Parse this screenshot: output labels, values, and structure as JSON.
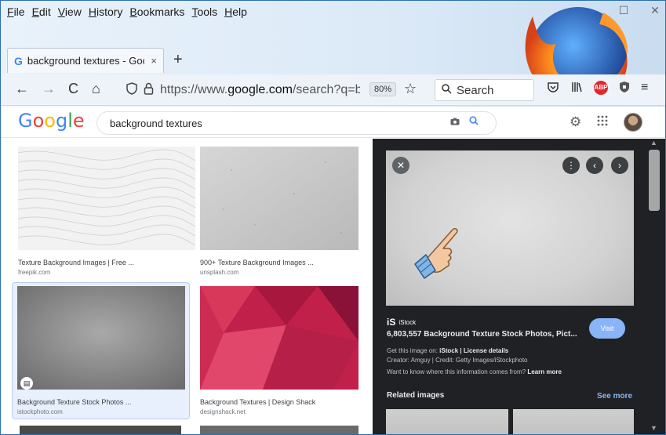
{
  "menu": [
    "File",
    "Edit",
    "View",
    "History",
    "Bookmarks",
    "Tools",
    "Help"
  ],
  "window_controls": {
    "minimize": "—",
    "maximize": "☐",
    "close": "✕"
  },
  "tab": {
    "favicon": "G",
    "title": "background textures - Goog",
    "close": "×"
  },
  "new_tab": "+",
  "nav": {
    "back": "←",
    "forward": "→",
    "reload": "C",
    "home": "⌂",
    "url_prefix": "https://www.",
    "url_domain": "google.com",
    "url_rest": "/search?q=bac",
    "zoom": "80%",
    "search_label": "Search"
  },
  "google": {
    "logo": [
      "G",
      "o",
      "o",
      "g",
      "l",
      "e"
    ],
    "query": "background textures"
  },
  "results": [
    {
      "title": "Texture Background Images | Free ...",
      "site": "freepik.com"
    },
    {
      "title": "900+ Texture Background Images ...",
      "site": "unsplash.com"
    },
    {
      "title": "Background Texture Stock Photos ...",
      "site": "istockphoto.com"
    },
    {
      "title": "Background Textures | Design Shack",
      "site": "designshack.net"
    }
  ],
  "panel": {
    "source_logo": "iS",
    "source_name": "iStock",
    "title": "6,803,557 Background Texture Stock Photos, Pict...",
    "visit": "Visit",
    "get_image_prefix": "Get this image on: ",
    "get_image_source": "iStock",
    "get_image_sep": " | ",
    "license": "License details",
    "creator": "Creator: Amguy | Credit: Getty Images/iStockphoto",
    "info_prefix": "Want to know where this information comes from? ",
    "learn_more": "Learn more",
    "related": "Related images",
    "see_more": "See more"
  },
  "colors": {
    "panel_bg": "#202124",
    "visit_btn": "#8ab4f8",
    "tab_favicon": "#4285f4",
    "abp_red": "#e4262e"
  }
}
